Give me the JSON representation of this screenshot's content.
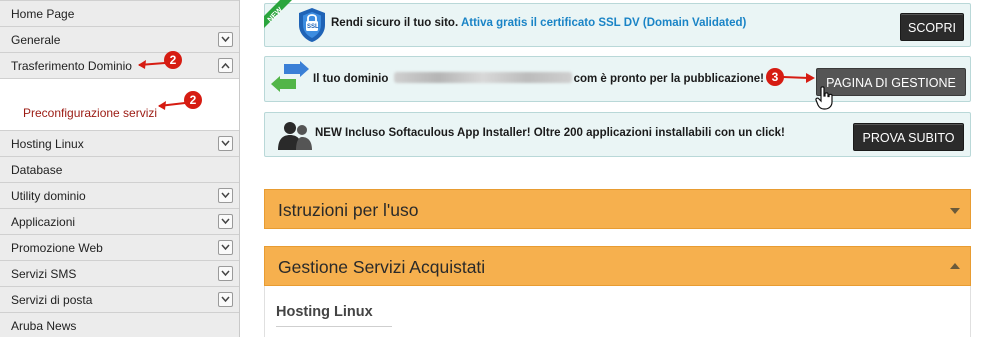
{
  "sidebar": {
    "items": [
      {
        "label": "Home Page",
        "toggle": "none"
      },
      {
        "label": "Generale",
        "toggle": "down"
      },
      {
        "label": "Trasferimento Dominio",
        "toggle": "up"
      },
      {
        "label": "Hosting Linux",
        "toggle": "down"
      },
      {
        "label": "Database",
        "toggle": "none"
      },
      {
        "label": "Utility dominio",
        "toggle": "down"
      },
      {
        "label": "Applicazioni",
        "toggle": "down"
      },
      {
        "label": "Promozione Web",
        "toggle": "down"
      },
      {
        "label": "Servizi SMS",
        "toggle": "down"
      },
      {
        "label": "Servizi di posta",
        "toggle": "down"
      },
      {
        "label": "Aruba News",
        "toggle": "none"
      }
    ],
    "submenu_item": "Preconfigurazione servizi"
  },
  "annotations": {
    "badge_transfer": "2",
    "badge_preconfig": "2",
    "badge_manage": "3",
    "color": "#d61c12"
  },
  "banners": {
    "ssl": {
      "ribbon": "NEW",
      "shield_text": "SSL",
      "text": "Rendi sicuro il tuo sito.",
      "link": "Attiva gratis il certificato SSL DV (Domain Validated)",
      "button": "SCOPRI"
    },
    "domain": {
      "text_before": "Il tuo dominio",
      "text_after": "com è pronto per la pubblicazione!",
      "button": "PAGINA DI GESTIONE"
    },
    "softaculous": {
      "text": "NEW Incluso Softaculous App Installer! Oltre 200 applicazioni installabili con un click!",
      "button": "PROVA SUBITO"
    }
  },
  "accordion": {
    "instructions": "Istruzioni per l'uso",
    "services": "Gestione Servizi Acquistati",
    "services_first_section": "Hosting Linux"
  },
  "colors": {
    "accordion": "#f6b04e",
    "banner_bg": "#eaf5f5",
    "link": "#1a84c6",
    "submenu_link": "#9b1a12"
  }
}
